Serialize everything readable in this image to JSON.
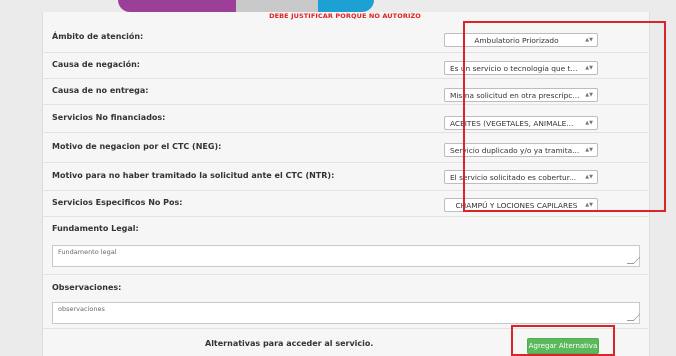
{
  "alert_text": "DEBE JUSTIFICAR PORQUE NO AUTORIZO",
  "fields": [
    {
      "label": "Ámbito de atención:",
      "value": "Ambulatorio Priorizado"
    },
    {
      "label": "Causa de negación:",
      "value": "Es un servicio o tecnología que t..."
    },
    {
      "label": "Causa de no entrega:",
      "value": "Misma solicitud en otra prescripc..."
    },
    {
      "label": "Servicios No financiados:",
      "value": "ACEITES (VEGETALES, ANIMALE..."
    },
    {
      "label": "Motivo de negacion por el CTC (NEG):",
      "value": "Servicio duplicado y/o ya tramita..."
    },
    {
      "label": "Motivo para no haber tramitado la solicitud ante el CTC (NTR):",
      "value": "El servicio solicitado es cobertur..."
    },
    {
      "label": "Servicios Especificos No Pos:",
      "value": "CHAMPÚ Y LOCIONES CAPILARES"
    }
  ],
  "fundamento": {
    "label": "Fundamento Legal:",
    "placeholder": "Fundamento legal"
  },
  "observaciones": {
    "label": "Observaciones:",
    "placeholder": "observaciones"
  },
  "alternativas": {
    "label": "Alternativas para acceder al servicio.",
    "button": "Agregar Alternativa"
  },
  "colors": {
    "highlight": "#d9242a",
    "alert": "#dd2222",
    "button": "#5cb85c"
  }
}
